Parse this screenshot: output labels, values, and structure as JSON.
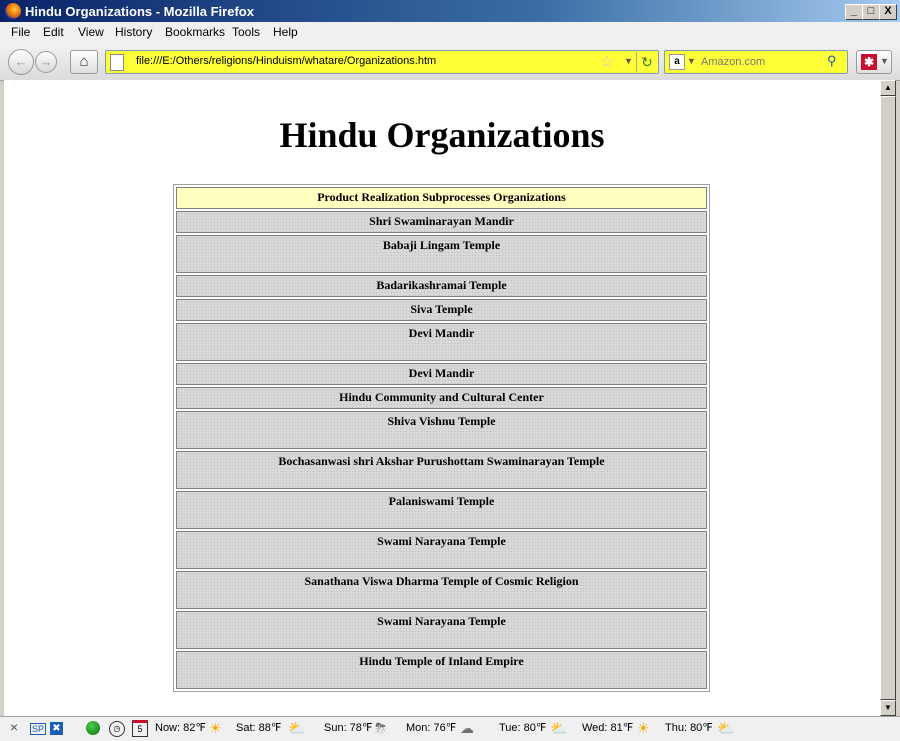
{
  "window": {
    "title": "Hindu Organizations - Mozilla Firefox",
    "min": "_",
    "max": "□",
    "close": "X"
  },
  "menu": [
    "File",
    "Edit",
    "View",
    "History",
    "Bookmarks",
    "Tools",
    "Help"
  ],
  "toolbar": {
    "url": "file:///E:/Others/religions/Hinduism/whatare/Organizations.htm",
    "search_placeholder": "Amazon.com",
    "icons": [
      "back-icon",
      "forward-icon",
      "home-icon",
      "bookmark-star-icon",
      "reload-icon",
      "search-icon"
    ]
  },
  "page": {
    "title": "Hindu Organizations",
    "table": {
      "header": "Product Realization Subprocesses Organizations",
      "rows": [
        {
          "name": "Shri Swaminarayan Mandir",
          "tall": false
        },
        {
          "name": "Babaji Lingam Temple",
          "tall": true
        },
        {
          "name": "Badarikashramai Temple",
          "tall": false
        },
        {
          "name": "Siva Temple",
          "tall": false
        },
        {
          "name": "Devi Mandir",
          "tall": true
        },
        {
          "name": "Devi Mandir",
          "tall": false
        },
        {
          "name": "Hindu Community and Cultural Center",
          "tall": false
        },
        {
          "name": "Shiva Vishnu Temple",
          "tall": true
        },
        {
          "name": "Bochasanwasi shri Akshar Purushottam Swaminarayan Temple",
          "tall": true
        },
        {
          "name": "Palaniswami Temple",
          "tall": true
        },
        {
          "name": "Swami Narayana Temple",
          "tall": true
        },
        {
          "name": "Sanathana Viswa Dharma Temple of Cosmic Religion",
          "tall": true
        },
        {
          "name": "Swami Narayana Temple",
          "tall": true
        },
        {
          "name": "Hindu Temple of Inland Empire",
          "tall": true
        }
      ]
    }
  },
  "statusbar": {
    "close": "×",
    "sp": "SP",
    "calendar_day": "5",
    "weather": [
      {
        "label": "Now: 82℉",
        "icon": "sun-icon"
      },
      {
        "label": "Sat: 88℉",
        "icon": "partly-cloudy-icon"
      },
      {
        "label": "Sun: 78℉",
        "icon": "thunderstorm-icon"
      },
      {
        "label": "Mon: 76℉",
        "icon": "rain-icon"
      },
      {
        "label": "Tue: 80℉",
        "icon": "partly-cloudy-icon"
      },
      {
        "label": "Wed: 81℉",
        "icon": "sun-icon"
      },
      {
        "label": "Thu: 80℉",
        "icon": "partly-cloudy-icon"
      }
    ]
  }
}
